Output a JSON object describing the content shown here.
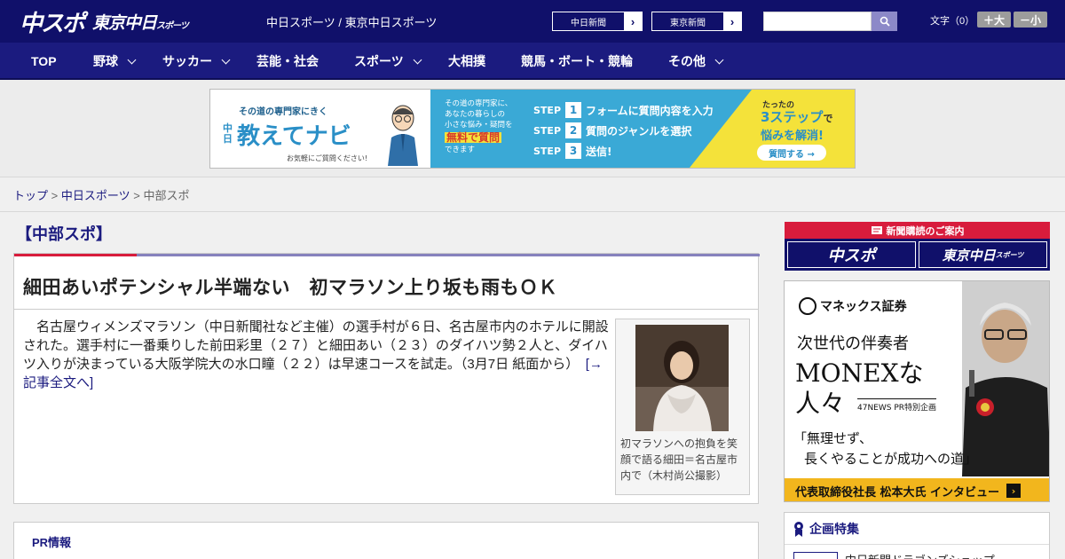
{
  "header": {
    "logo_primary": "中スポ",
    "logo_secondary": "東京中日",
    "logo_secondary_small": "スポーツ",
    "site_title": "中日スポーツ / 東京中日スポーツ",
    "ext_links": [
      {
        "label": "中日新聞"
      },
      {
        "label": "東京新聞"
      }
    ],
    "search": {
      "placeholder": ""
    },
    "font_size_label": "文字（0）",
    "font_larger": "＋大",
    "font_smaller": "－小",
    "colors": {
      "bg": "#10106a",
      "nav": "#1b1b7f",
      "accent_red": "#d81c3c"
    }
  },
  "nav": {
    "items": [
      {
        "label": "TOP",
        "has_menu": false
      },
      {
        "label": "野球",
        "has_menu": true
      },
      {
        "label": "サッカー",
        "has_menu": true
      },
      {
        "label": "芸能・社会",
        "has_menu": false
      },
      {
        "label": "スポーツ",
        "has_menu": true
      },
      {
        "label": "大相撲",
        "has_menu": false
      },
      {
        "label": "競馬・ボート・競輪",
        "has_menu": false
      },
      {
        "label": "その他",
        "has_menu": true
      }
    ]
  },
  "ad_banner": {
    "tagline": "その道の専門家にきく",
    "brand_prefix": "中日",
    "brand": "教えてナビ",
    "note": "お気軽にご質問ください!",
    "desc_lines": [
      "その道の専門家に、",
      "あなたの暮らしの",
      "小さな悩み・疑問を"
    ],
    "desc_highlight": "無料で質問",
    "desc_end": "できます",
    "steps": [
      {
        "word": "STEP",
        "num": "1",
        "text": "フォームに質問内容を入力"
      },
      {
        "word": "STEP",
        "num": "2",
        "text": "質問のジャンルを選択"
      },
      {
        "word": "STEP",
        "num": "3",
        "text": "送信!"
      }
    ],
    "right_top": "たったの",
    "right_big": "3ステップ",
    "right_big_suffix": "で",
    "right_line2": "悩みを解消!",
    "right_button": "質問する →"
  },
  "breadcrumb": {
    "items": [
      {
        "label": "トップ",
        "link": true
      },
      {
        "label": "中日スポーツ",
        "link": true
      },
      {
        "label": "中部スポ",
        "link": false
      }
    ],
    "separator": ">"
  },
  "main": {
    "section_title": "【中部スポ】",
    "article": {
      "headline": "細田あいポテンシャル半端ない　初マラソン上り坂も雨もＯＫ",
      "body": "名古屋ウィメンズマラソン（中日新聞社など主催）の選手村が６日、名古屋市内のホテルに開設された。選手村に一番乗りした前田彩里（２７）と細田あい（２３）のダイハツ勢２人と、ダイハツ入りが決まっている大阪学院大の水口瞳（２２）は早速コースを試走。（3月7日 紙面から）",
      "more_link": "[→記事全文へ]",
      "photo_caption": "初マラソンへの抱負を笑顔で語る細田＝名古屋市内で（木村尚公撮影）"
    },
    "pr_title": "PR情報"
  },
  "sidebar": {
    "subscribe_head": "新聞購読のご案内",
    "subscribe_buttons": [
      {
        "label": "中スポ"
      },
      {
        "label": "東京中日"
      }
    ],
    "subscribe_small": "スポーツ",
    "monex_ad": {
      "logo": "マネックス証券",
      "line1": "次世代の伴奏者",
      "line2": "MONEXな",
      "line3": "人々",
      "tag": "47NEWS PR特別企画",
      "quote_1": "「無理せず、",
      "quote_2": "長くやることが成功への道」",
      "bar": "代表取締役社長  松本大氏 インタビュー",
      "bar_arrow": "›"
    },
    "feature_title": "企画特集",
    "feature_item": "中日新聞ドラゴンズショップ"
  }
}
